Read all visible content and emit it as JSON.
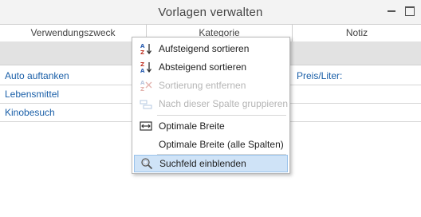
{
  "window": {
    "title": "Vorlagen verwalten"
  },
  "columns": [
    "Verwendungszweck",
    "Kategorie",
    "Notiz"
  ],
  "rows": [
    {
      "zweck": "Auto auftanken",
      "kategorie": "",
      "notiz": "Preis/Liter:"
    },
    {
      "zweck": "Lebensmittel",
      "kategorie": "",
      "notiz": ""
    },
    {
      "zweck": "Kinobesuch",
      "kategorie": "",
      "notiz": ""
    }
  ],
  "context_menu": {
    "items": [
      {
        "label": "Aufsteigend sortieren",
        "icon": "sort-ascending-icon",
        "enabled": true
      },
      {
        "label": "Absteigend sortieren",
        "icon": "sort-descending-icon",
        "enabled": true
      },
      {
        "label": "Sortierung entfernen",
        "icon": "clear-sort-icon",
        "enabled": false
      },
      {
        "label": "Nach dieser Spalte gruppieren",
        "icon": "group-by-icon",
        "enabled": false
      },
      {
        "label": "Optimale Breite",
        "icon": "best-fit-icon",
        "enabled": true
      },
      {
        "label": "Optimale Breite (alle Spalten)",
        "icon": "",
        "enabled": true
      },
      {
        "label": "Suchfeld einblenden",
        "icon": "search-icon",
        "enabled": true,
        "highlighted": true
      }
    ]
  },
  "colors": {
    "link": "#1a5fa8",
    "highlight": "#cfe3f7",
    "filter_row": "#e2e2e2"
  }
}
